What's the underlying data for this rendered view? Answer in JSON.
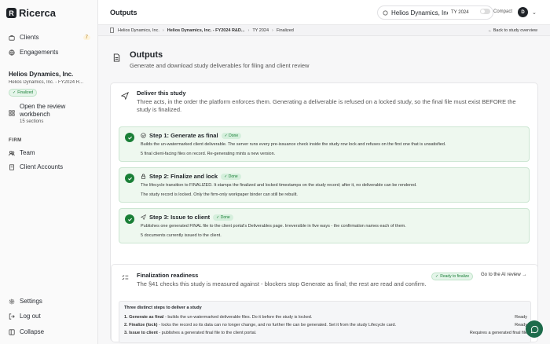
{
  "brand": {
    "name": "Ricerca",
    "mark": "R"
  },
  "sidebar": {
    "items": [
      {
        "label": "Clients",
        "icon": "briefcase-icon",
        "count": "7"
      },
      {
        "label": "Engagements",
        "icon": "globe-icon"
      }
    ],
    "client": {
      "name": "Helios Dynamics, Inc.",
      "sub": "Helios Dynamics, Inc. - FY2024 R...",
      "status": "Finalized"
    },
    "review": {
      "title": "Open the review workbench",
      "sub": "15 sections"
    },
    "firm_heading": "FIRM",
    "firm_items": [
      {
        "label": "Team",
        "icon": "users-icon"
      },
      {
        "label": "Client Accounts",
        "icon": "building-icon"
      }
    ],
    "bottom_items": [
      {
        "label": "Settings",
        "icon": "gear-icon"
      },
      {
        "label": "Log out",
        "icon": "logout-icon"
      },
      {
        "label": "Collapse",
        "icon": "collapse-icon"
      }
    ]
  },
  "topbar": {
    "title": "Outputs",
    "client_select": "Helios Dynamics, Inc.",
    "year": "TY 2024",
    "compact_label": "Compact",
    "avatar": "D"
  },
  "breadcrumb": {
    "items": [
      "Helios Dynamics, Inc.",
      "Helios Dynamics, Inc. - FY2024 R&D...",
      "TY 2024",
      "Finalized"
    ],
    "back": "Back to study overview"
  },
  "hero": {
    "title": "Outputs",
    "subtitle": "Generate and download study deliverables for filing and client review"
  },
  "deliver": {
    "title": "Deliver this study",
    "subtitle": "Three acts, in the order the platform enforces them. Generating a deliverable is refused on a locked study, so the final file must exist BEFORE the study is finalized.",
    "steps": [
      {
        "title": "Step 1: Generate as final",
        "status": "Done",
        "line1": "Builds the un-watermarked client deliverable. The server runs every pre-issuance check inside the study row lock and refuses on the first one that is unsatisfied.",
        "line2": "5 final client-facing files on record. Re-generating mints a new version."
      },
      {
        "title": "Step 2: Finalize and lock",
        "status": "Done",
        "line1": "The lifecycle transition to FINALIZED. It stamps the finalized and locked timestamps on the study record; after it, no deliverable can be rendered.",
        "line2": "The study record is locked. Only the firm-only workpaper binder can still be rebuilt."
      },
      {
        "title": "Step 3: Issue to client",
        "status": "Done",
        "line1": "Publishes one generated FINAL file to the client portal's Deliverables page. Irreversible in five ways - the confirmation names each of them.",
        "line2": "5 documents currently issued to the client."
      }
    ]
  },
  "finalization": {
    "title": "Finalization readiness",
    "subtitle": "The §41 checks this study is measured against - blockers stop Generate as final; the rest are read and confirm.",
    "status": "Ready to finalize",
    "link": "Go to the AI review",
    "box_heading": "Three distinct steps to deliver a study",
    "rows": [
      {
        "bold": "1. Generate as final",
        "text": " - builds the un-watermarked deliverable files. Do it before the study is locked.",
        "status": "Ready"
      },
      {
        "bold": "2. Finalize (lock)",
        "text": " - locks the record so its data can no longer change, and no further file can be generated. Set it from the study Lifecycle card.",
        "status": "Ready"
      },
      {
        "bold": "3. Issue to client",
        "text": " - publishes a generated final file to the client portal.",
        "status": "Requires a generated final file"
      }
    ]
  }
}
